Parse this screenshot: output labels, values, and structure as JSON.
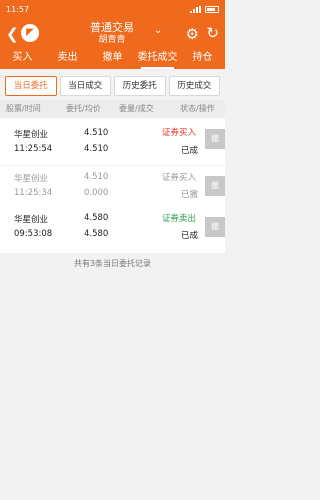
{
  "status_bar": {
    "time": "11:57"
  },
  "header": {
    "title": "普通交易",
    "subtitle": "胡青青",
    "chevron": "⌄",
    "back_icon": "❮",
    "logo_icon": "◤",
    "gear_icon": "⚙",
    "refresh_icon": "↻"
  },
  "main_tabs": [
    "买入",
    "卖出",
    "撤单",
    "委托成交",
    "持仓"
  ],
  "sub_tabs": [
    "当日委托",
    "当日成交",
    "历史委托",
    "历史成交"
  ],
  "columns": [
    "股票/时间",
    "委托/均价",
    "委量/成交",
    "状态/操作"
  ],
  "orders": [
    {
      "name": "华星创业",
      "time": "11:25:54",
      "price": "4.510",
      "avg": "4.510",
      "status_top": "证券买入",
      "status_bottom": "已成",
      "cancel": "撤"
    },
    {
      "name": "华星创业",
      "time": "11:25:34",
      "price": "4.510",
      "avg": "0.000",
      "status_top": "证券买入",
      "status_bottom": "已撤",
      "cancel": "撤"
    },
    {
      "name": "华星创业",
      "time": "09:53:08",
      "price": "4.580",
      "avg": "4.580",
      "status_top": "证券卖出",
      "status_bottom": "已成",
      "cancel": "撤"
    }
  ],
  "footer": "共有3条当日委托记录",
  "colors": {
    "brand": "#f06a1e",
    "buy": "#e8352b",
    "sell": "#2aa04a"
  }
}
